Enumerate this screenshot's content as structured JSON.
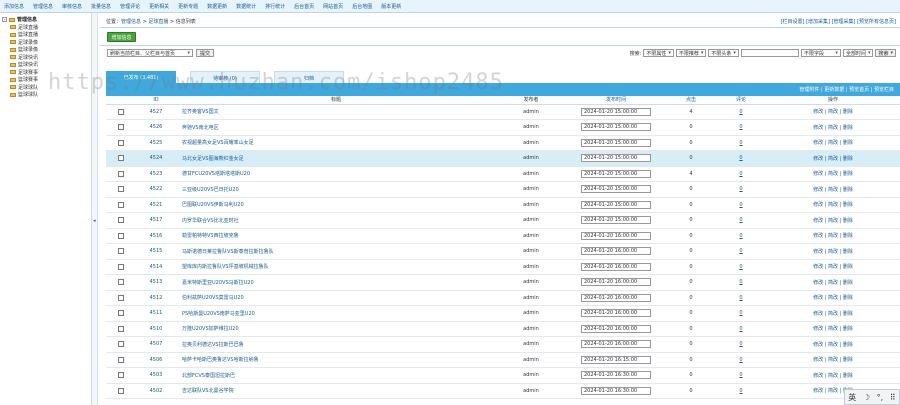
{
  "topnav": [
    "添加信息",
    "管理信息",
    "审核信息",
    "批量信息",
    "管理评论",
    "更新相关",
    "更新专题",
    "数据更新",
    "数据统计",
    "排行统计",
    "后台首页",
    "网站首页",
    "后台地图",
    "版本更新"
  ],
  "sidebar": {
    "root": "管理信息",
    "items": [
      "足球直播",
      "篮球直播",
      "足球录像",
      "篮球录像",
      "足球快讯",
      "篮球快讯",
      "足球赛事",
      "篮球赛事",
      "足球球队",
      "篮球球队"
    ]
  },
  "breadcrumb": {
    "label": "位置：",
    "home": "管理信息",
    "sep": " > ",
    "c1": "足球直播",
    "c2": "信息列表"
  },
  "toplinks": "[栏目设置] [增加采集] [管理采集] [预览所有信息页]",
  "add_button": "增加信息",
  "category_select": "刷新当前栏目、父栏目与首页",
  "go_button": "提交",
  "search": {
    "label": "搜索:",
    "f1": "不限属性",
    "f2": "不限推荐",
    "f3": "不限头条",
    "f4": "不限字段",
    "f5": "全部时间",
    "submit": "搜索"
  },
  "tabs": [
    "已发布 (3,481)",
    "待审核 (0)",
    "归档"
  ],
  "tab_links": "管理附件 | 更新数据 | 预览首页 | 预览栏目",
  "table": {
    "headers": [
      "",
      "ID",
      "标题",
      "发布者",
      "发布时间",
      "点击",
      "评论",
      "操作"
    ],
    "ops": "修改 | 简改 | 删除",
    "rows": [
      {
        "id": "4527",
        "title": "拉齐奥客VS国文",
        "author": "admin",
        "time": "2024-01-20 15:00:00",
        "clicks": "4",
        "comments": "0"
      },
      {
        "id": "4526",
        "title": "奔驰VS南北电区",
        "author": "admin",
        "time": "2024-01-20 15:00:00",
        "clicks": "0",
        "comments": "0"
      },
      {
        "id": "4525",
        "title": "农视超量高女足VS百耀率山女足",
        "author": "admin",
        "time": "2024-01-20 15:00:00",
        "clicks": "0",
        "comments": "0"
      },
      {
        "id": "4524",
        "title": "马北女足VS图海熊红金女足",
        "author": "admin",
        "time": "2024-01-20 15:00:00",
        "clicks": "0",
        "comments": "0"
      },
      {
        "id": "4523",
        "title": "德甘FCU20VS塔斯塔塔斯U20",
        "author": "admin",
        "time": "2024-01-20 15:00:00",
        "clicks": "4",
        "comments": "0"
      },
      {
        "id": "4522",
        "title": "三亚级U20VS巴日托U20",
        "author": "admin",
        "time": "2024-01-20 15:00:00",
        "clicks": "0",
        "comments": "0"
      },
      {
        "id": "4521",
        "title": "巴图联U20VS伊斯马利U20",
        "author": "admin",
        "time": "2024-01-20 15:00:00",
        "clicks": "0",
        "comments": "0"
      },
      {
        "id": "4517",
        "title": "内罗华联合VS比北亚时社",
        "author": "admin",
        "time": "2024-01-20 15:00:00",
        "clicks": "0",
        "comments": "0"
      },
      {
        "id": "4516",
        "title": "勒雷帕特特VS西拉坡克鲁",
        "author": "admin",
        "time": "2024-01-20 16:00:00",
        "clicks": "0",
        "comments": "0"
      },
      {
        "id": "4515",
        "title": "马斯诺德日莱拉鲁队VS斯泰普拉斯拉鲁队",
        "author": "admin",
        "time": "2024-01-20 16:00:00",
        "clicks": "0",
        "comments": "0"
      },
      {
        "id": "4514",
        "title": "望库库内斯拉鲁队VS坪基坡机械拉鲁队",
        "author": "admin",
        "time": "2024-01-20 16:00:00",
        "clicks": "0",
        "comments": "0"
      },
      {
        "id": "4513",
        "title": "嘉米特斯里亚U20VS马斯拉U20",
        "author": "admin",
        "time": "2024-01-20 16:00:00",
        "clicks": "0",
        "comments": "0"
      },
      {
        "id": "4512",
        "title": "伯利兹萨U20VS莫雷马U20",
        "author": "admin",
        "time": "2024-01-20 16:00:00",
        "clicks": "0",
        "comments": "0"
      },
      {
        "id": "4511",
        "title": "PS哈斯曼U20VS南萨马亚里U20",
        "author": "admin",
        "time": "2024-01-20 16:00:00",
        "clicks": "0",
        "comments": "0"
      },
      {
        "id": "4510",
        "title": "万隆U20VS加萨维拉U20",
        "author": "admin",
        "time": "2024-01-20 16:00:00",
        "clicks": "0",
        "comments": "0"
      },
      {
        "id": "4507",
        "title": "拉奥贝利德达VS拉斯巴巴鲁",
        "author": "admin",
        "time": "2024-01-20 16:00:00",
        "clicks": "0",
        "comments": "0"
      },
      {
        "id": "4506",
        "title": "哈萨卡哈斯巴奥鲁达VS哈斯拉纳鲁",
        "author": "admin",
        "time": "2024-01-20 16:15:00",
        "clicks": "0",
        "comments": "0"
      },
      {
        "id": "4503",
        "title": "北部FCVS泰国坦拉斯巴",
        "author": "admin",
        "time": "2024-01-20 16:30:00",
        "clicks": "0",
        "comments": "0"
      },
      {
        "id": "4502",
        "title": "吉达联队VS北曼谷学院",
        "author": "admin",
        "time": "2024-01-20 16:30:00",
        "clicks": "0",
        "comments": "0"
      }
    ]
  },
  "watermark": "https://www.huzhan.com/ishop2485",
  "ime": {
    "lang": "英",
    "moon": "☽",
    "dot": "°,",
    "grid": "⠿"
  },
  "colors": {
    "accent": "#3fa8dc",
    "nav": "#1a5a94",
    "add": "#4aa33a",
    "highlight": "#d7eef9"
  }
}
